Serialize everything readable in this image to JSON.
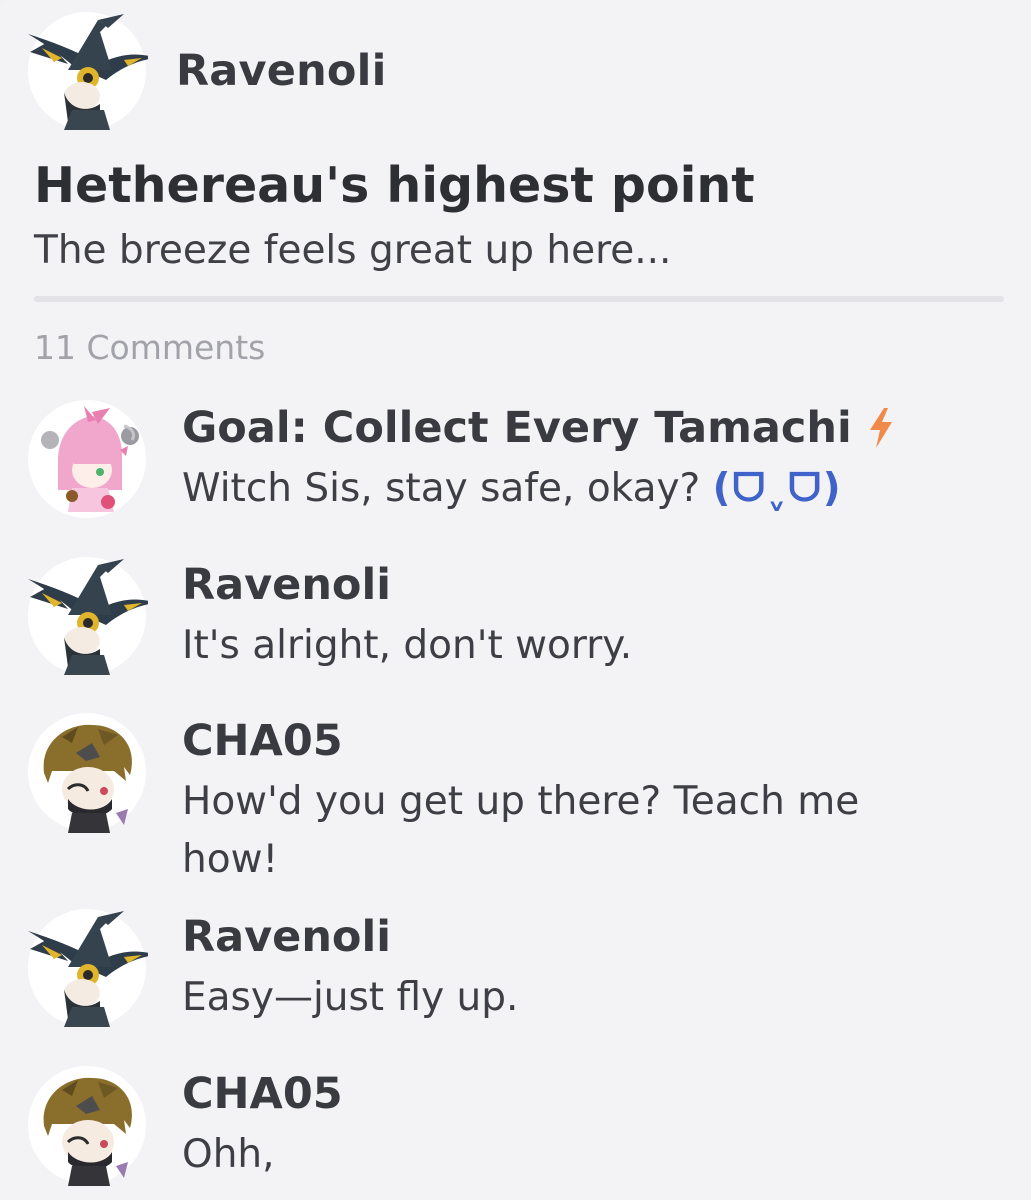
{
  "post": {
    "author": {
      "name": "Ravenoli",
      "avatar_icon": "witch-hat-avatar-icon"
    },
    "title": "Hethereau's highest point",
    "subtitle": "The breeze feels great up here..."
  },
  "comments_header": {
    "count_label": "11 Comments"
  },
  "comments": [
    {
      "name": "Goal: Collect Every Tamachi",
      "badge_icon": "lightning-bolt-icon",
      "text": "Witch Sis, stay safe, okay?",
      "kaomoji": "(ᗜˬᗜ)",
      "avatar_icon": "pink-hair-avatar-icon"
    },
    {
      "name": "Ravenoli",
      "text": "It's alright, don't worry.",
      "avatar_icon": "witch-hat-avatar-icon"
    },
    {
      "name": "CHA05",
      "text": "How'd you get up there? Teach me how!",
      "avatar_icon": "brown-hair-avatar-icon"
    },
    {
      "name": "Ravenoli",
      "text": "Easy—just fly up.",
      "avatar_icon": "witch-hat-avatar-icon"
    },
    {
      "name": "CHA05",
      "text": "Ohh,",
      "avatar_icon": "brown-hair-avatar-icon"
    }
  ],
  "colors": {
    "bolt": "#f08a4b",
    "kaomoji": "#3f63c8",
    "meta": "#a2a3a8"
  }
}
